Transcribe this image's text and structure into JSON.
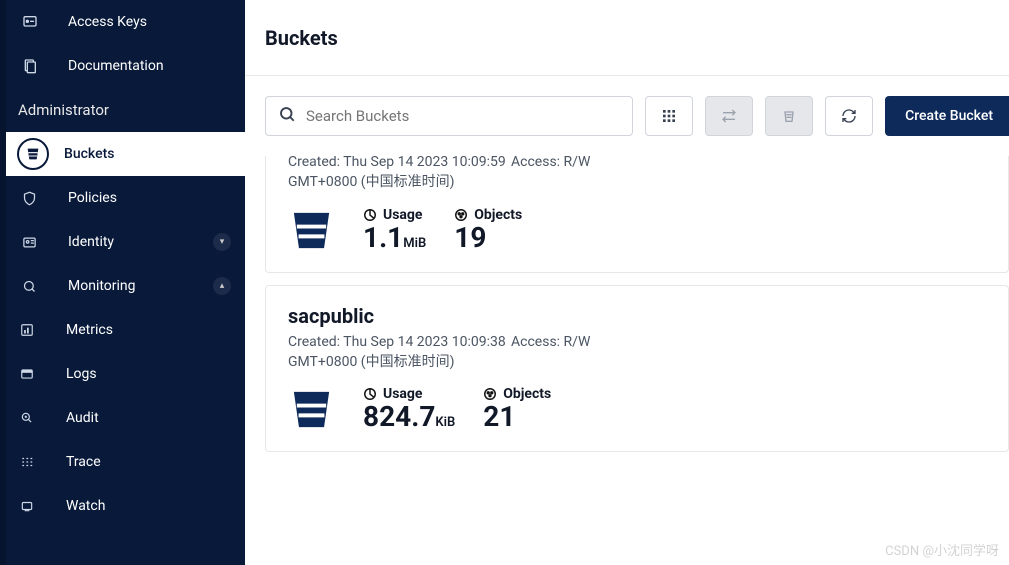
{
  "colors": {
    "sidebar_bg": "#08193a",
    "primary": "#0d2a5b"
  },
  "header": {
    "title": "Buckets"
  },
  "sidebar": {
    "top_items": [
      {
        "label": "Access Keys",
        "icon": "key-icon"
      },
      {
        "label": "Documentation",
        "icon": "doc-icon"
      }
    ],
    "section_title": "Administrator",
    "items": [
      {
        "label": "Buckets",
        "icon": "bucket-icon",
        "active": true
      },
      {
        "label": "Policies",
        "icon": "shield-icon"
      },
      {
        "label": "Identity",
        "icon": "id-icon",
        "expandable": true,
        "expanded": false
      },
      {
        "label": "Monitoring",
        "icon": "monitor-icon",
        "expandable": true,
        "expanded": true,
        "children": [
          {
            "label": "Metrics",
            "icon": "metrics-icon"
          },
          {
            "label": "Logs",
            "icon": "logs-icon"
          },
          {
            "label": "Audit",
            "icon": "audit-icon"
          },
          {
            "label": "Trace",
            "icon": "trace-icon"
          },
          {
            "label": "Watch",
            "icon": "watch-icon"
          }
        ]
      }
    ]
  },
  "toolbar": {
    "search_placeholder": "Search Buckets",
    "grid_icon": "grid-view-icon",
    "replication_icon": "replication-icon",
    "lifecycle_icon": "lifecycle-icon",
    "refresh_icon": "refresh-icon",
    "create_label": "Create Bucket"
  },
  "buckets": [
    {
      "name_visible": false,
      "created_label": "Created:",
      "created_value": "Thu Sep 14 2023 10:09:59 GMT+0800 (中国标准时间)",
      "access_label": "Access:",
      "access_value": "R/W",
      "usage_label": "Usage",
      "usage_value": "1.1",
      "usage_unit": "MiB",
      "objects_label": "Objects",
      "objects_value": "19"
    },
    {
      "name_visible": true,
      "name": "sacpublic",
      "created_label": "Created:",
      "created_value": "Thu Sep 14 2023 10:09:38 GMT+0800 (中国标准时间)",
      "access_label": "Access:",
      "access_value": "R/W",
      "usage_label": "Usage",
      "usage_value": "824.7",
      "usage_unit": "KiB",
      "objects_label": "Objects",
      "objects_value": "21"
    }
  ],
  "watermark": "CSDN @小沈同学呀"
}
